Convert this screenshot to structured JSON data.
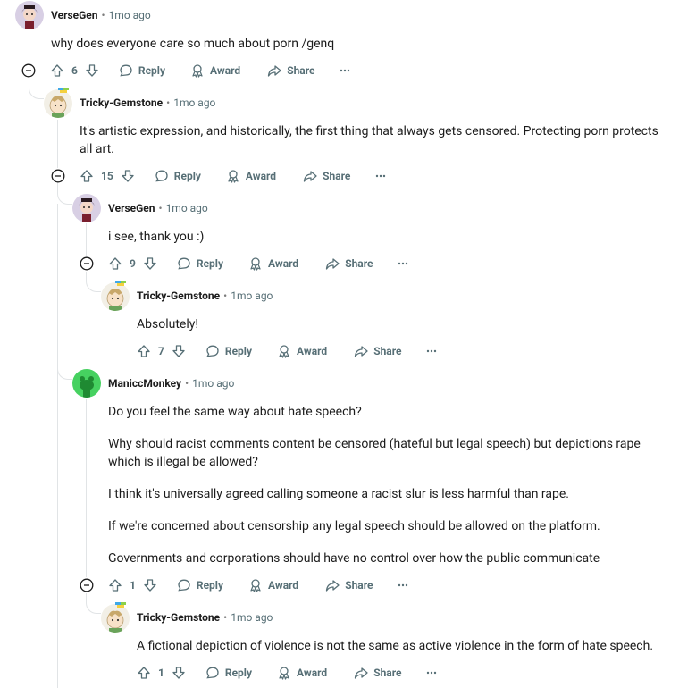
{
  "separator": "•",
  "actions": {
    "reply": "Reply",
    "award": "Award",
    "share": "Share"
  },
  "colors": {
    "accent": "#0079d3",
    "line": "#e1e4e6",
    "meta": "#576f76"
  },
  "comments": [
    {
      "author": "VerseGen",
      "time": "1mo ago",
      "score": "6",
      "body": [
        "why does everyone care so much about porn /genq"
      ]
    },
    {
      "author": "Tricky-Gemstone",
      "time": "1mo ago",
      "score": "15",
      "body": [
        "It's artistic expression, and historically, the first thing that always gets censored. Protecting porn protects all art."
      ]
    },
    {
      "author": "VerseGen",
      "time": "1mo ago",
      "score": "9",
      "body": [
        "i see, thank you :)"
      ]
    },
    {
      "author": "Tricky-Gemstone",
      "time": "1mo ago",
      "score": "7",
      "body": [
        "Absolutely!"
      ]
    },
    {
      "author": "ManiccMonkey",
      "time": "1mo ago",
      "score": "1",
      "body": [
        "Do you feel the same way about hate speech?",
        "Why should racist comments content be censored (hateful but legal speech) but depictions rape which is illegal be allowed?",
        "I think it's universally agreed calling someone a racist slur is less harmful than rape.",
        "If we're concerned about censorship any legal speech should be allowed on the platform.",
        "Governments and corporations should have no control over how the public communicate"
      ]
    },
    {
      "author": "Tricky-Gemstone",
      "time": "1mo ago",
      "score": "1",
      "body": [
        "A fictional depiction of violence is not the same as active violence in the form of hate speech."
      ]
    }
  ]
}
